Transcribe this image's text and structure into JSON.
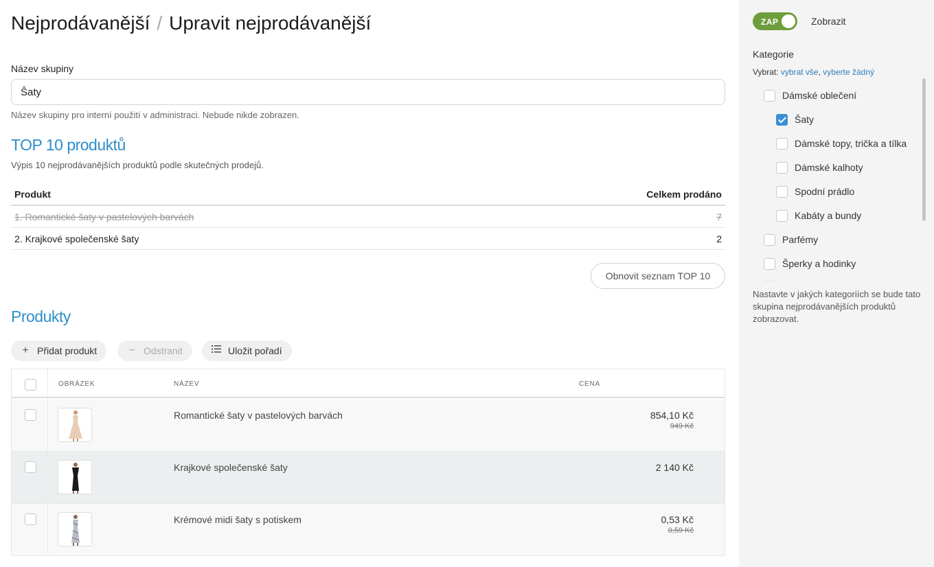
{
  "breadcrumb": {
    "parent": "Nejprodávanější",
    "separator": "/",
    "current": "Upravit nejprodávanější"
  },
  "group_name": {
    "label": "Název skupiny",
    "value": "Šaty",
    "help": "Název skupiny pro interní použití v administraci. Nebude nikde zobrazen."
  },
  "top10": {
    "title": "TOP 10 produktů",
    "description": "Výpis 10 nejprodávanějších produktů podle skutečných prodejů.",
    "col_product": "Produkt",
    "col_total": "Celkem prodáno",
    "rows": [
      {
        "name": "1. Romantické šaty v pastelových barvách",
        "sold": "7",
        "struck": true
      },
      {
        "name": "2. Krajkové společenské šaty",
        "sold": "2",
        "struck": false
      }
    ],
    "refresh_label": "Obnovit seznam TOP 10"
  },
  "products": {
    "title": "Produkty",
    "toolbar": {
      "add_label": "Přidat produkt",
      "remove_label": "Odstranit",
      "save_order_label": "Uložit pořadí"
    },
    "columns": {
      "image": "OBRÁZEK",
      "name": "NÁZEV",
      "price": "CENA"
    },
    "rows": [
      {
        "name": "Romantické šaty v pastelových barvách",
        "price": "854,10 Kč",
        "old_price": "949 Kč",
        "dress_color": "#e8cdb6"
      },
      {
        "name": "Krajkové společenské šaty",
        "price": "2 140 Kč",
        "old_price": "",
        "dress_color": "#1a1a1a"
      },
      {
        "name": "Krémové midi šaty s potiskem",
        "price": "0,53 Kč",
        "old_price": "0,59 Kč",
        "dress_color": "#b9bdc9"
      }
    ]
  },
  "sidebar": {
    "toggle_label": "ZAP",
    "toggle_caption": "Zobrazit",
    "categories_title": "Kategorie",
    "select_prefix": "Vybrat:",
    "select_all": "vybrat vše",
    "select_none": "vyberte žádný",
    "categories": [
      {
        "label": "Dámské oblečení",
        "checked": false
      },
      {
        "label": "Šaty",
        "checked": true
      },
      {
        "label": "Dámské topy, trička a tílka",
        "checked": false
      },
      {
        "label": "Dámské kalhoty",
        "checked": false
      },
      {
        "label": "Spodní prádlo",
        "checked": false
      },
      {
        "label": "Kabáty a bundy",
        "checked": false
      },
      {
        "label": "Parfémy",
        "checked": false
      },
      {
        "label": "Šperky a hodinky",
        "checked": false
      }
    ],
    "help": "Nastavte v jakých kategoriích se bude tato skupina nejprodávanějších produktů zobrazovat."
  },
  "colors": {
    "accent": "#2d8ec9",
    "toggle_on": "#6e9d3d",
    "checkbox_checked": "#3a8fd6"
  }
}
